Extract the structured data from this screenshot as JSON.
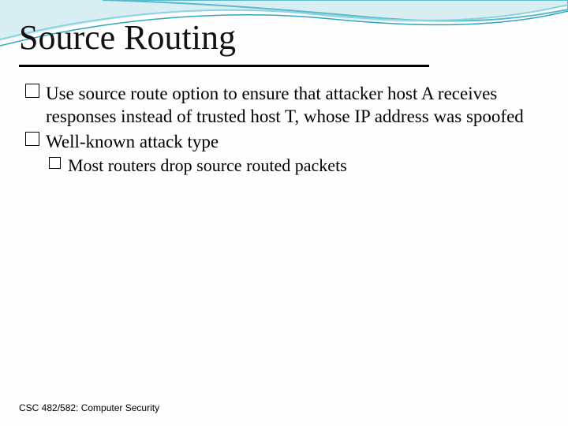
{
  "slide": {
    "title": "Source Routing",
    "bullets_l1": [
      {
        "text": "Use source route option to ensure that attacker host A receives responses instead of trusted host T, whose IP address was spoofed"
      },
      {
        "text": "Well-known attack type"
      }
    ],
    "bullets_l2": [
      {
        "text": "Most routers drop source routed packets"
      }
    ],
    "footer": "CSC 482/582: Computer Security"
  },
  "theme": {
    "wave_color_light": "#c9e8ef",
    "wave_color_mid": "#6fc5d6",
    "wave_color_dark": "#2a9fb8",
    "rule_color": "#000000"
  }
}
